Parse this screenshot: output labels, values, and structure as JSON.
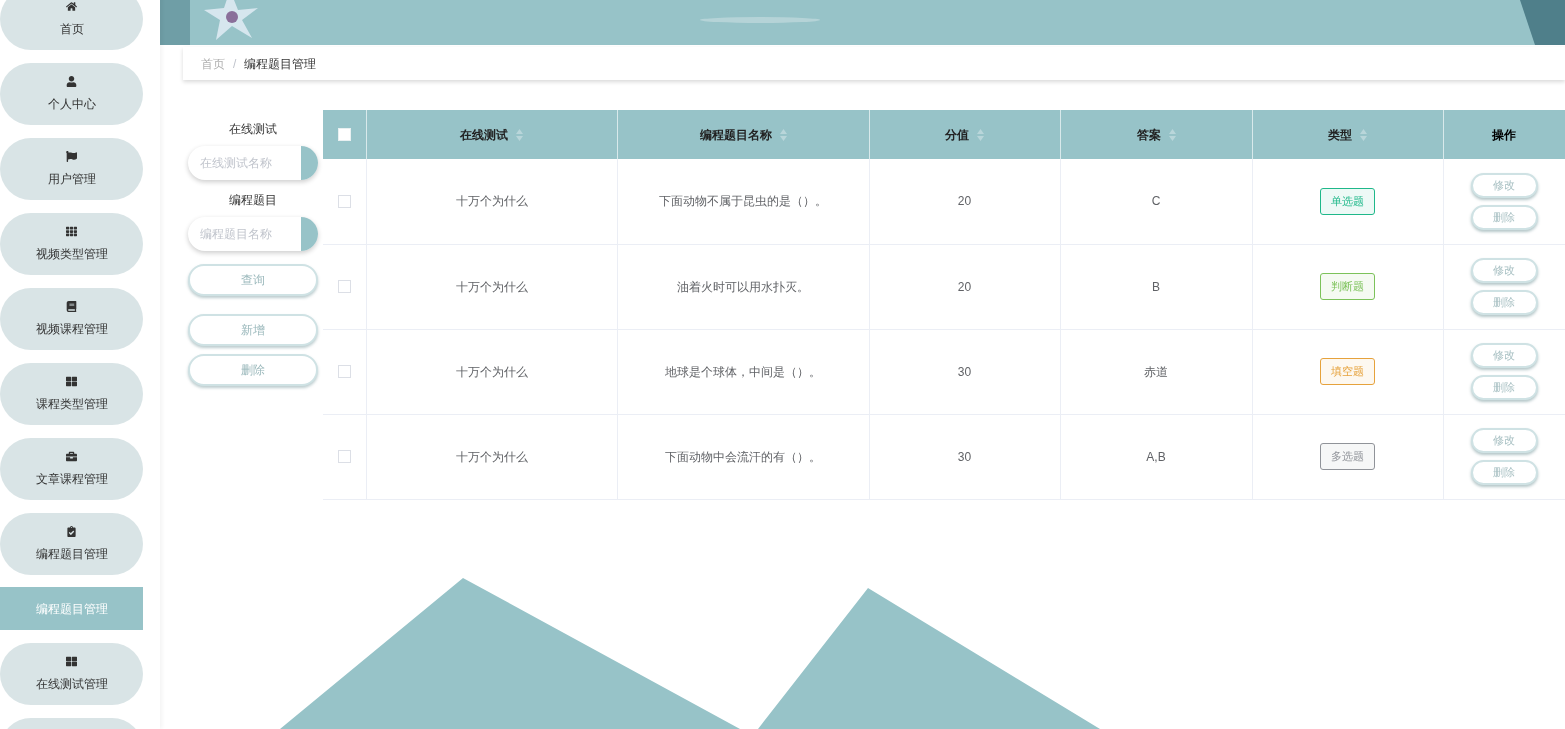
{
  "sidebar": {
    "items": [
      {
        "label": "首页"
      },
      {
        "label": "个人中心"
      },
      {
        "label": "用户管理"
      },
      {
        "label": "视频类型管理"
      },
      {
        "label": "视频课程管理"
      },
      {
        "label": "课程类型管理"
      },
      {
        "label": "文章课程管理"
      },
      {
        "label": "编程题目管理",
        "children": [
          {
            "label": "编程题目管理",
            "selected": true
          }
        ]
      },
      {
        "label": "在线测试管理"
      }
    ]
  },
  "breadcrumb": {
    "separator": "/",
    "items": [
      "首页",
      "编程题目管理"
    ]
  },
  "search": {
    "fields": [
      {
        "label": "在线测试",
        "placeholder": "在线测试名称"
      },
      {
        "label": "编程题目",
        "placeholder": "编程题目名称"
      }
    ],
    "buttons": [
      "查询",
      "新增",
      "删除"
    ]
  },
  "table": {
    "select_all": {
      "checked": false
    },
    "columns": [
      {
        "label": "在线测试",
        "sortable": true
      },
      {
        "label": "编程题目名称",
        "sortable": true
      },
      {
        "label": "分值",
        "sortable": true
      },
      {
        "label": "答案",
        "sortable": true
      },
      {
        "label": "类型",
        "sortable": true
      },
      {
        "label": "操作",
        "sortable": false
      }
    ],
    "rows": [
      {
        "checked": false,
        "test": "十万个为什么",
        "question": "下面动物不属于昆虫的是（）。",
        "score": "20",
        "answer": "C",
        "type": {
          "label": "单选题",
          "color": "#1fb88a"
        },
        "actions": [
          "修改",
          "删除"
        ]
      },
      {
        "checked": false,
        "test": "十万个为什么",
        "question": "油着火时可以用水扑灭。",
        "score": "20",
        "answer": "B",
        "type": {
          "label": "判断题",
          "color": "#7cc25a"
        },
        "actions": [
          "修改",
          "删除"
        ]
      },
      {
        "checked": false,
        "test": "十万个为什么",
        "question": "地球是个球体，中间是（）。",
        "score": "30",
        "answer": "赤道",
        "type": {
          "label": "填空题",
          "color": "#e6a23c"
        },
        "actions": [
          "修改",
          "删除"
        ]
      },
      {
        "checked": false,
        "test": "十万个为什么",
        "question": "下面动物中会流汗的有（）。",
        "score": "30",
        "answer": "A,B",
        "type": {
          "label": "多选题",
          "color": "#909399"
        },
        "actions": [
          "修改",
          "删除"
        ]
      }
    ]
  }
}
